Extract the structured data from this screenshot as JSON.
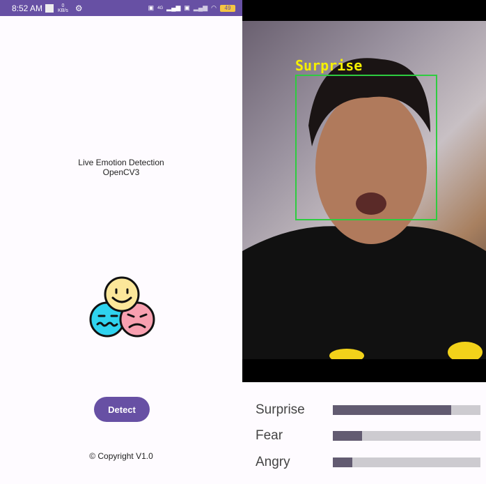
{
  "status_bar": {
    "time": "8:52 AM",
    "net_speed": "0",
    "net_unit": "KB/s",
    "battery": "49",
    "net_type": "4G"
  },
  "main": {
    "title_line1": "Live Emotion Detection",
    "title_line2": "OpenCV3",
    "detect_label": "Detect",
    "copyright": "© Copyright V1.0"
  },
  "camera": {
    "detected_label": "Surprise",
    "box_color": "#2ecc40",
    "label_color": "#f5f000"
  },
  "emotions": [
    {
      "label": "Surprise",
      "level": 0.8
    },
    {
      "label": "Fear",
      "level": 0.2
    },
    {
      "label": "Angry",
      "level": 0.13
    }
  ],
  "colors": {
    "primary": "#6750a4",
    "bar_fill": "#625b71",
    "bar_track": "#cdcbd0"
  }
}
